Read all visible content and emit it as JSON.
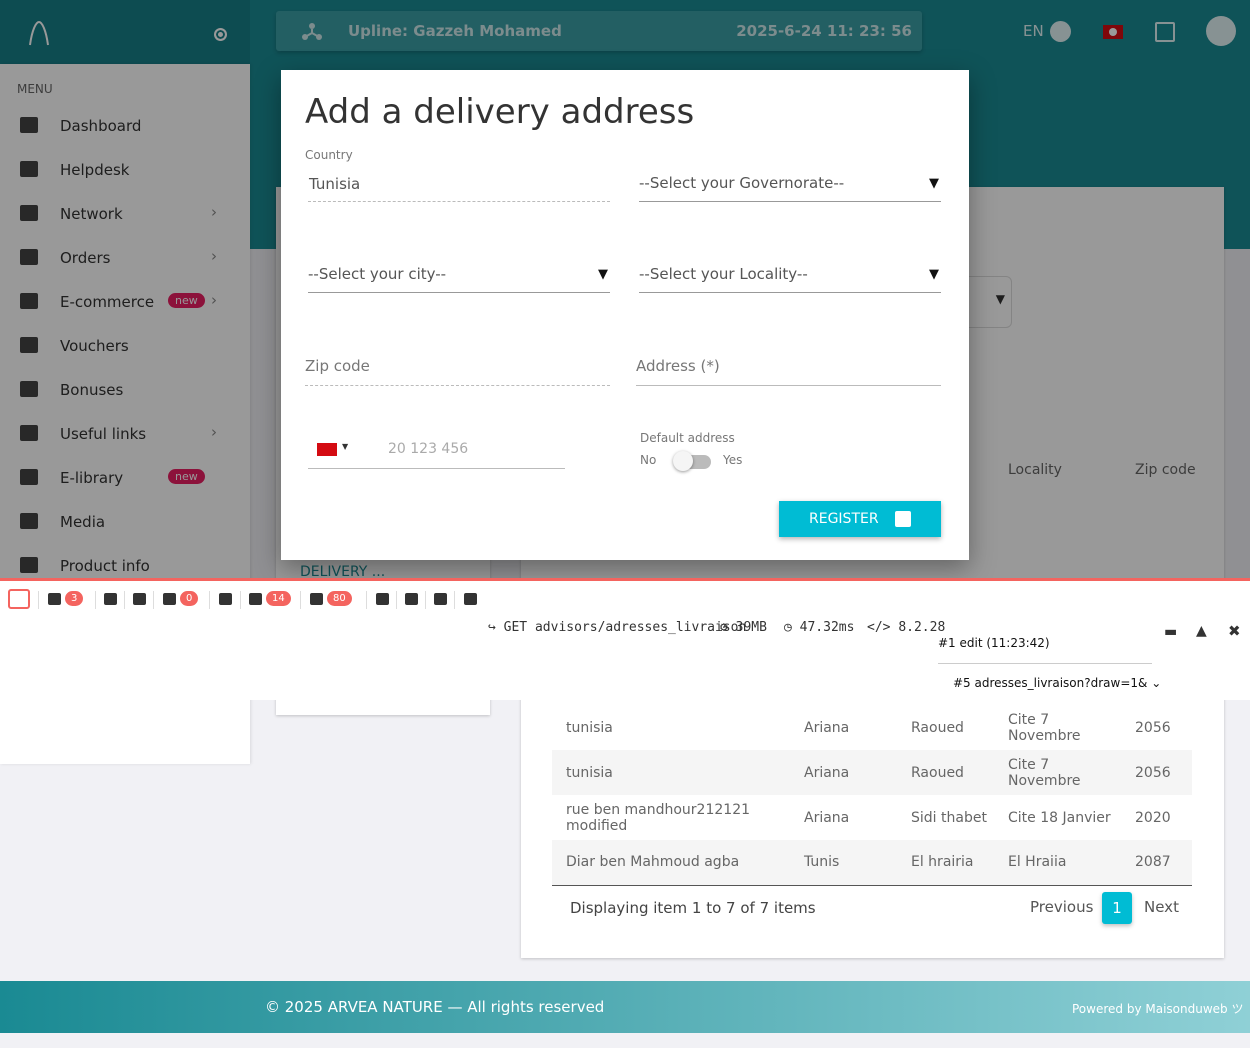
{
  "header": {
    "upline_label": "Upline: Gazzeh Mohamed",
    "datetime": "2025-6-24 11: 23: 56",
    "lang": "EN"
  },
  "sidebar": {
    "menu_title": "MENU",
    "items": [
      {
        "label": "Dashboard",
        "icon": "dashboard-icon",
        "chevron": false,
        "badge": ""
      },
      {
        "label": "Helpdesk",
        "icon": "headset-icon",
        "chevron": false,
        "badge": ""
      },
      {
        "label": "Network",
        "icon": "people-icon",
        "chevron": true,
        "badge": ""
      },
      {
        "label": "Orders",
        "icon": "cart-icon",
        "chevron": true,
        "badge": ""
      },
      {
        "label": "E-commerce",
        "icon": "store-icon",
        "chevron": true,
        "badge": "new"
      },
      {
        "label": "Vouchers",
        "icon": "voucher-icon",
        "chevron": false,
        "badge": ""
      },
      {
        "label": "Bonuses",
        "icon": "dollar-icon",
        "chevron": false,
        "badge": ""
      },
      {
        "label": "Useful links",
        "icon": "link-icon",
        "chevron": true,
        "badge": ""
      },
      {
        "label": "E-library",
        "icon": "library-icon",
        "chevron": false,
        "badge": "new"
      },
      {
        "label": "Media",
        "icon": "media-icon",
        "chevron": false,
        "badge": ""
      },
      {
        "label": "Product info",
        "icon": "chart-icon",
        "chevron": false,
        "badge": ""
      }
    ]
  },
  "left_card": {
    "delivery_link": "DELIVERY ..."
  },
  "table": {
    "headers": [
      "Locality",
      "Zip code"
    ],
    "rows": [
      [
        "tunisia",
        "Ariana",
        "Raoued",
        "Cite 7 Novembre",
        "2056"
      ],
      [
        "tunisia",
        "Ariana",
        "Raoued",
        "Cite 7 Novembre",
        "2056"
      ],
      [
        "rue ben mandhour212121 modified",
        "Ariana",
        "Sidi thabet",
        "Cite 18 Janvier",
        "2020"
      ],
      [
        "Diar ben Mahmoud agba",
        "Tunis",
        "El hrairia",
        "El Hraiia",
        "2087"
      ]
    ],
    "footer_info": "Displaying item 1 to 7 of 7 items",
    "prev": "Previous",
    "page": "1",
    "next": "Next"
  },
  "footer": {
    "copyright": "© 2025 ARVEA NATURE — All rights reserved",
    "powered": "Powered by Maisonduweb ツ"
  },
  "modal": {
    "title": "Add a delivery address",
    "country_label": "Country",
    "country_value": "Tunisia",
    "governorate_placeholder": "--Select your Governorate--",
    "city_placeholder": "--Select your city--",
    "locality_placeholder": "--Select your Locality--",
    "zip_placeholder": "Zip code",
    "address_placeholder": "Address (*)",
    "phone_placeholder": "20 123 456",
    "default_label": "Default address",
    "no": "No",
    "yes": "Yes",
    "register": "REGISTER"
  },
  "debugbar": {
    "counts": {
      "messages": "3",
      "exceptions": "0",
      "queries": "14",
      "models": "80"
    },
    "request": "GET advisors/adresses_livraison",
    "memory": "39MB",
    "time": "47.32ms",
    "php": "8.2.28",
    "edit": "#1 edit (11:23:42)",
    "draw": "#5 adresses_livraison?draw=1&"
  },
  "colors": {
    "teal": "#1a8a93",
    "accent": "#00bcd4",
    "badge": "#e91e63",
    "debug": "#f4645f"
  }
}
